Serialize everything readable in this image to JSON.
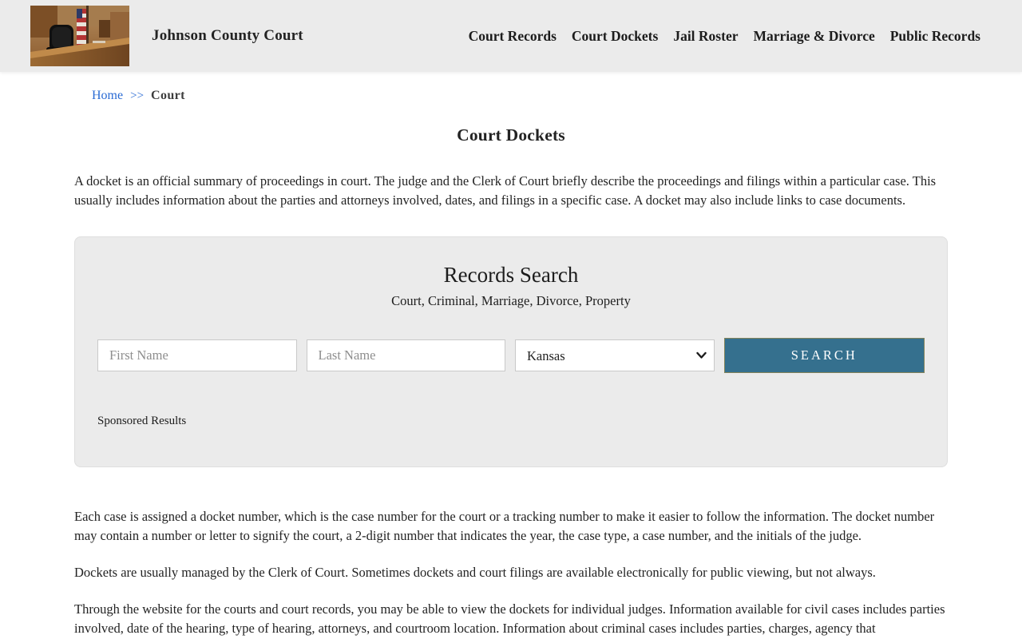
{
  "header": {
    "site_title": "Johnson County Court",
    "nav": [
      {
        "label": "Court Records"
      },
      {
        "label": "Court Dockets"
      },
      {
        "label": "Jail Roster"
      },
      {
        "label": "Marriage & Divorce"
      },
      {
        "label": "Public Records"
      }
    ]
  },
  "breadcrumb": {
    "home": "Home",
    "separator": ">>",
    "current": "Court"
  },
  "page": {
    "title": "Court Dockets",
    "intro": "A docket is an official summary of proceedings in court. The judge and the Clerk of Court briefly describe the proceedings and filings within a particular case. This usually includes information about the parties and attorneys involved, dates, and filings in a specific case. A docket may also include links to case documents.",
    "paragraphs": [
      "Each case is assigned a docket number, which is the case number for the court or a tracking number to make it easier to follow the information. The docket number may contain a number or letter to signify the court, a 2-digit number that indicates the year, the case type, a case number, and the initials of the judge.",
      "Dockets are usually managed by the Clerk of Court. Sometimes dockets and court filings are available electronically for public viewing, but not always.",
      "Through the website for the courts and court records, you may be able to view the dockets for individual judges. Information available for civil cases includes parties involved, date of the hearing, type of hearing, attorneys, and courtroom location. Information about criminal cases includes parties, charges, agency that"
    ]
  },
  "search": {
    "title": "Records Search",
    "subtitle": "Court, Criminal, Marriage, Divorce, Property",
    "first_name_placeholder": "First Name",
    "last_name_placeholder": "Last Name",
    "state_selected": "Kansas",
    "button_label": "SEARCH",
    "sponsored_label": "Sponsored Results"
  },
  "colors": {
    "header_bg": "#ebebeb",
    "panel_bg": "#ebebeb",
    "button_bg": "#35708e",
    "button_border": "#83835a",
    "link_blue": "#2a6bd4",
    "text": "#232323"
  }
}
